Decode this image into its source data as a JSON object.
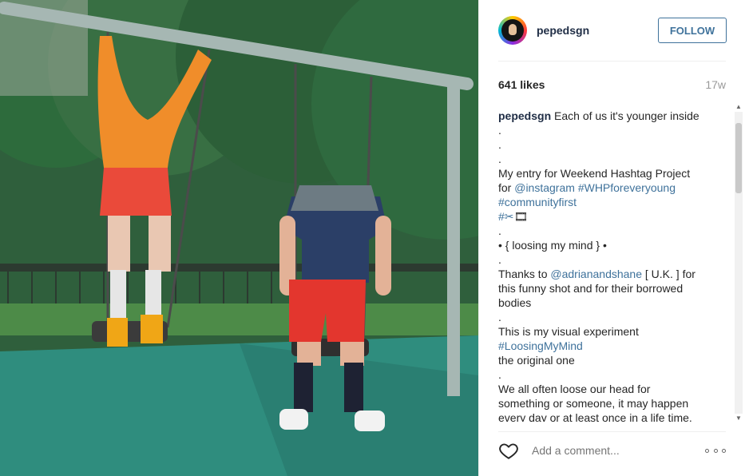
{
  "post": {
    "username": "pepedsgn",
    "follow_label": "FOLLOW",
    "likes": "641 likes",
    "age": "17w",
    "comment_placeholder": "Add a comment...",
    "caption_lines": [
      {
        "type": "first",
        "user": "pepedsgn",
        "text": " Each of us it's younger inside"
      },
      {
        "type": "text",
        "text": "."
      },
      {
        "type": "text",
        "text": "."
      },
      {
        "type": "text",
        "text": "."
      },
      {
        "type": "text",
        "text": "My entry for Weekend Hashtag Project"
      },
      {
        "type": "mixed",
        "parts": [
          {
            "t": "for "
          },
          {
            "t": "@instagram",
            "link": true
          },
          {
            "t": " "
          },
          {
            "t": "#WHPforeveryoung",
            "link": true
          }
        ]
      },
      {
        "type": "mixed",
        "parts": [
          {
            "t": "#communityfirst",
            "link": true
          }
        ]
      },
      {
        "type": "mixed",
        "parts": [
          {
            "t": "#✂︎",
            "link": true
          },
          {
            "t": "🎞"
          }
        ]
      },
      {
        "type": "text",
        "text": "."
      },
      {
        "type": "text",
        "text": "• { loosing my mind } •"
      },
      {
        "type": "text",
        "text": "."
      },
      {
        "type": "mixed",
        "parts": [
          {
            "t": "Thanks to "
          },
          {
            "t": "@adrianandshane",
            "link": true
          },
          {
            "t": " [ U.K. ] for"
          }
        ]
      },
      {
        "type": "text",
        "text": "this funny shot and for their borrowed"
      },
      {
        "type": "text",
        "text": "bodies"
      },
      {
        "type": "text",
        "text": "."
      },
      {
        "type": "text",
        "text": "This is my visual experiment"
      },
      {
        "type": "mixed",
        "parts": [
          {
            "t": "#LoosingMyMind",
            "link": true
          }
        ]
      },
      {
        "type": "text",
        "text": "the original one"
      },
      {
        "type": "text",
        "text": "."
      },
      {
        "type": "text",
        "text": "We all often loose our head for"
      },
      {
        "type": "text",
        "text": "something or someone, it may happen"
      },
      {
        "type": "text",
        "text": "every day or at least once in a life time."
      }
    ]
  },
  "icons": {
    "heart": "heart-icon",
    "more": "more-options-icon",
    "avatar": "profile-avatar"
  }
}
